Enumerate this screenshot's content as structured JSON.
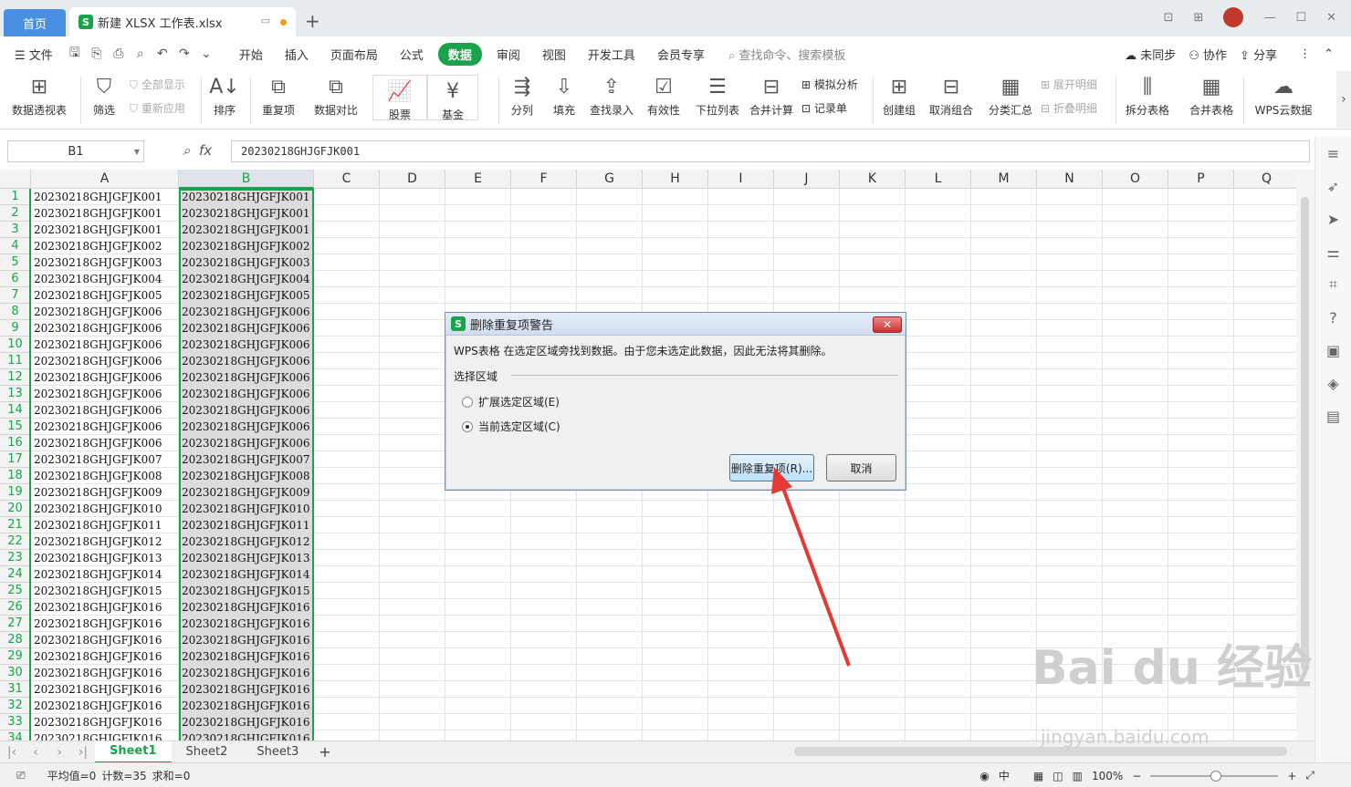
{
  "titlebar": {
    "home_tab": "首页",
    "file_tab": "新建 XLSX 工作表.xlsx",
    "file_badge": "S"
  },
  "menu": {
    "file": "文件",
    "items": [
      "开始",
      "插入",
      "页面布局",
      "公式",
      "数据",
      "审阅",
      "视图",
      "开发工具",
      "会员专享"
    ],
    "active": "数据",
    "search": "查找命令、搜索模板",
    "right": [
      "未同步",
      "协作",
      "分享"
    ]
  },
  "ribbon": {
    "pivot": "数据透视表",
    "filter": "筛选",
    "show_all": "全部显示",
    "reapply": "重新应用",
    "sort": "排序",
    "duplicates": "重复项",
    "compare": "数据对比",
    "stock": "股票",
    "fund": "基金",
    "split_col": "分列",
    "fill": "填充",
    "lookup": "查找录入",
    "validity": "有效性",
    "dropdown": "下拉列表",
    "consolidate": "合并计算",
    "simulate": "模拟分析",
    "record": "记录单",
    "group": "创建组",
    "ungroup": "取消组合",
    "subtotal": "分类汇总",
    "expand": "展开明细",
    "collapse": "折叠明细",
    "split_table": "拆分表格",
    "merge_table": "合并表格",
    "wps_cloud": "WPS云数据"
  },
  "formula": {
    "cell_ref": "B1",
    "fx": "fx",
    "value": "20230218GHJGFJK001"
  },
  "columns": [
    "A",
    "B",
    "C",
    "D",
    "E",
    "F",
    "G",
    "H",
    "I",
    "J",
    "K",
    "L",
    "M",
    "N",
    "O",
    "P",
    "Q"
  ],
  "rows": {
    "A": [
      "20230218GHJGFJK001",
      "20230218GHJGFJK001",
      "20230218GHJGFJK001",
      "20230218GHJGFJK002",
      "20230218GHJGFJK003",
      "20230218GHJGFJK004",
      "20230218GHJGFJK005",
      "20230218GHJGFJK006",
      "20230218GHJGFJK006",
      "20230218GHJGFJK006",
      "20230218GHJGFJK006",
      "20230218GHJGFJK006",
      "20230218GHJGFJK006",
      "20230218GHJGFJK006",
      "20230218GHJGFJK006",
      "20230218GHJGFJK006",
      "20230218GHJGFJK007",
      "20230218GHJGFJK008",
      "20230218GHJGFJK009",
      "20230218GHJGFJK010",
      "20230218GHJGFJK011",
      "20230218GHJGFJK012",
      "20230218GHJGFJK013",
      "20230218GHJGFJK014",
      "20230218GHJGFJK015",
      "20230218GHJGFJK016",
      "20230218GHJGFJK016",
      "20230218GHJGFJK016",
      "20230218GHJGFJK016",
      "20230218GHJGFJK016",
      "20230218GHJGFJK016",
      "20230218GHJGFJK016",
      "20230218GHJGFJK016",
      "20230218GHJGFJK016"
    ],
    "B": [
      "20230218GHJGFJK001",
      "20230218GHJGFJK001",
      "20230218GHJGFJK001",
      "20230218GHJGFJK002",
      "20230218GHJGFJK003",
      "20230218GHJGFJK004",
      "20230218GHJGFJK005",
      "20230218GHJGFJK006",
      "20230218GHJGFJK006",
      "20230218GHJGFJK006",
      "20230218GHJGFJK006",
      "20230218GHJGFJK006",
      "20230218GHJGFJK006",
      "20230218GHJGFJK006",
      "20230218GHJGFJK006",
      "20230218GHJGFJK006",
      "20230218GHJGFJK007",
      "20230218GHJGFJK008",
      "20230218GHJGFJK009",
      "20230218GHJGFJK010",
      "20230218GHJGFJK011",
      "20230218GHJGFJK012",
      "20230218GHJGFJK013",
      "20230218GHJGFJK014",
      "20230218GHJGFJK015",
      "20230218GHJGFJK016",
      "20230218GHJGFJK016",
      "20230218GHJGFJK016",
      "20230218GHJGFJK016",
      "20230218GHJGFJK016",
      "20230218GHJGFJK016",
      "20230218GHJGFJK016",
      "20230218GHJGFJK016",
      "20230218GHJGFJK016"
    ]
  },
  "dialog": {
    "title": "删除重复项警告",
    "message": "WPS表格 在选定区域旁找到数据。由于您未选定此数据，因此无法将其删除。",
    "group_label": "选择区域",
    "option_expand": "扩展选定区域(E)",
    "option_current": "当前选定区域(C)",
    "selected_option": "current",
    "primary_button": "删除重复项(R)...",
    "cancel_button": "取消"
  },
  "sheets": [
    "Sheet1",
    "Sheet2",
    "Sheet3"
  ],
  "active_sheet": "Sheet1",
  "status": {
    "average": "平均值=0",
    "count": "计数=35",
    "sum": "求和=0",
    "zoom": "100%",
    "input_mode": "中"
  },
  "watermark": {
    "main": "Bai du 经验",
    "url": "jingyan.baidu.com"
  },
  "colors": {
    "accent": "#1aa34a",
    "home_tab": "#4a90e2",
    "arrow": "#e53935"
  }
}
